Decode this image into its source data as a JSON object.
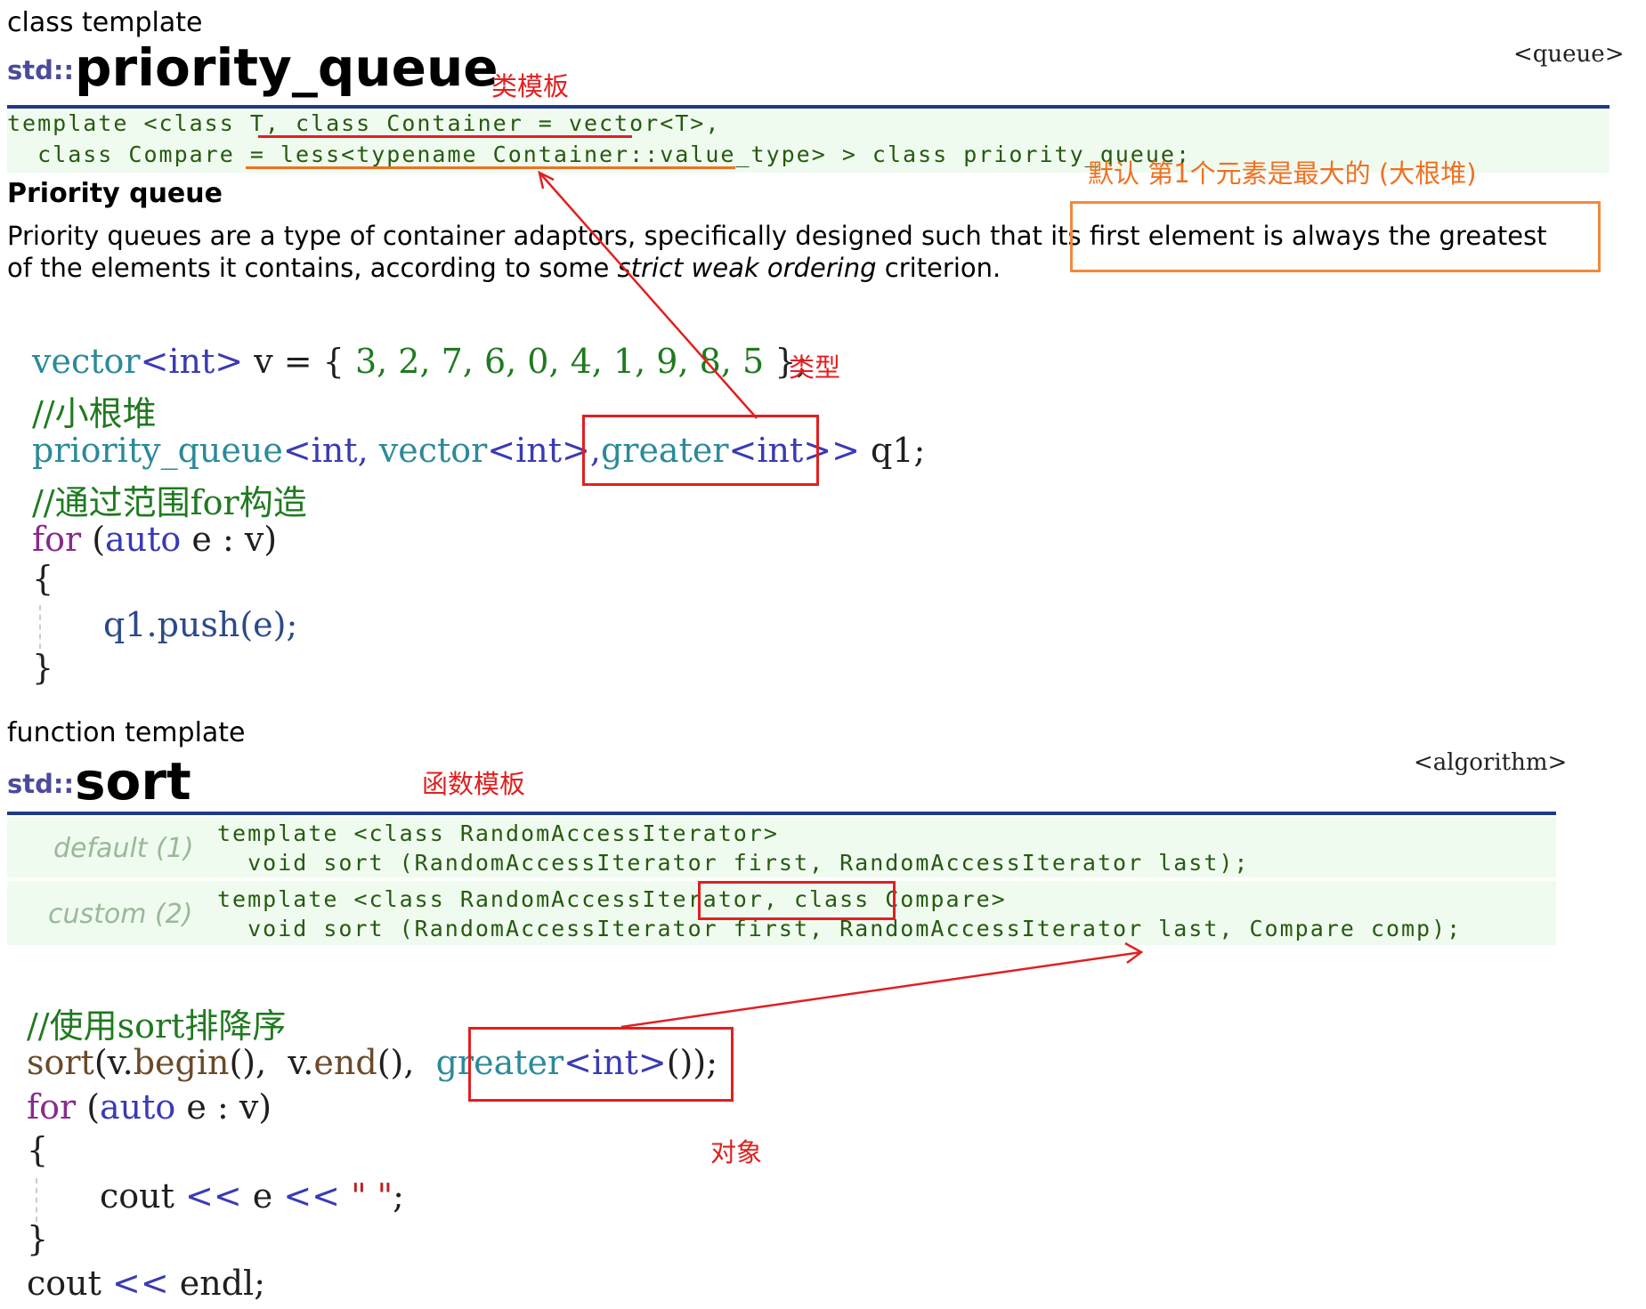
{
  "pq": {
    "kind": "class template",
    "std_prefix": "std::",
    "name": "priority_queue",
    "header": "<queue>",
    "annotation_title": "类模板",
    "proto_line1": "template <class T, class Container = vector<T>,",
    "proto_line2": "  class Compare = less<typename Container::value_type> > class priority_queue;",
    "annotation_default": "默认 第1个元素是最大的 (大根堆)",
    "section_title": "Priority queue",
    "desc_line1_a": "Priority queues are a type of container adaptors, specifically designed such that ",
    "desc_line1_b": "its first element is always the greatest",
    "desc_line2_a": "of the elements it contains, according to some ",
    "desc_line2_em": "strict weak ordering",
    "desc_line2_b": " criterion."
  },
  "code1": {
    "line1_a": "vector",
    "line1_b": "<int>",
    "line1_c": " v = { ",
    "line1_nums": "3, 2, 7, 6, 0, 4, 1, 9, 8, 5",
    "line1_d": " };",
    "annotation_type": "类型",
    "line2": "//小根堆",
    "line3_a": "priority_queue",
    "line3_b": "<int, ",
    "line3_c": "vector",
    "line3_d": "<int>,",
    "line3_e": "greater",
    "line3_f": "<int>>",
    "line3_g": " q1;",
    "line4": "//通过范围for构造",
    "line5_a": "for",
    "line5_b": " (",
    "line5_c": "auto",
    "line5_d": " e : v)",
    "line6": "{",
    "line7": "q1.push(e);",
    "line8": "}"
  },
  "sort": {
    "kind": "function template",
    "std_prefix": "std::",
    "name": "sort",
    "header": "<algorithm>",
    "annotation_title": "函数模板",
    "label_default": "default (1)",
    "default_line1": "template <class RandomAccessIterator>",
    "default_line2": "  void sort (RandomAccessIterator first, RandomAccessIterator last);",
    "label_custom": "custom (2)",
    "custom_line1_a": "template <class RandomAccessIterator, ",
    "custom_line1_b": "class Compare>",
    "custom_line2": "  void sort (RandomAccessIterator first, RandomAccessIterator last, Compare comp);"
  },
  "code2": {
    "line1": "//使用sort排降序",
    "line2_a": "sort",
    "line2_b": "(v.",
    "line2_c": "begin",
    "line2_d": "(),  v.",
    "line2_e": "end",
    "line2_f": "(),  ",
    "line2_g": "greater",
    "line2_h": "<int>",
    "line2_i": "());",
    "line3_a": "for",
    "line3_b": " (",
    "line3_c": "auto",
    "line3_d": " e : v)",
    "line4": "{",
    "line5_a": "cout ",
    "line5_b": "<<",
    "line5_c": " e ",
    "line5_d": "<<",
    "line5_e": " \" \"",
    "line5_f": ";",
    "line6": "}",
    "line7_a": "cout ",
    "line7_b": "<<",
    "line7_c": " endl;",
    "annotation_object": "对象"
  },
  "colors": {
    "annotation_red": "#e02020",
    "annotation_orange": "#f07020",
    "rule_blue": "#1e3a8a",
    "proto_green_bg": "#f0fbf0"
  }
}
